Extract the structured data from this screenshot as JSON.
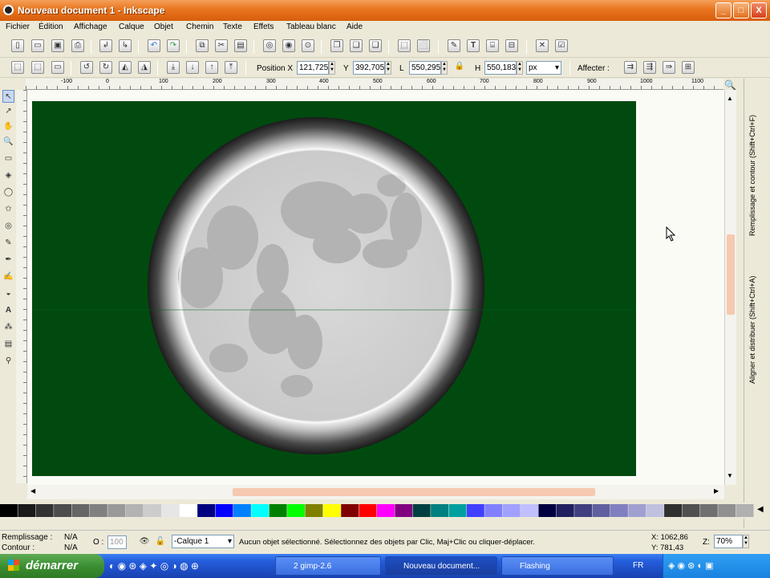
{
  "window": {
    "title": "Nouveau document 1 - Inkscape",
    "btn_min": "_",
    "btn_max": "□",
    "btn_close": "X"
  },
  "menu": [
    "Fichier",
    "Édition",
    "Affichage",
    "Calque",
    "Objet",
    "Chemin",
    "Texte",
    "Effets",
    "Tableau blanc",
    "Aide"
  ],
  "toolbar": {
    "position_x_label": "Position X",
    "x_value": "121,725",
    "y_label": "Y",
    "y_value": "392,705",
    "w_label": "L",
    "w_value": "550,295",
    "h_label": "H",
    "h_value": "550,183",
    "unit": "px",
    "affecter_label": "Affecter :"
  },
  "ruler": {
    "labels": [
      "-100",
      "0",
      "100",
      "200",
      "300",
      "400",
      "500",
      "600",
      "700",
      "800",
      "900",
      "1000",
      "1100"
    ]
  },
  "dock": {
    "tab1": "Remplissage et contour (Shift+Ctrl+F)",
    "tab2": "Aligner et distribuer (Shift+Ctrl+A)"
  },
  "colors": {
    "page_bg": "#004a0f",
    "moon_surface": "#d4d4d4",
    "moon_maria": "#b3b3b3"
  },
  "palette": [
    "#000000",
    "#1a1a1a",
    "#333333",
    "#4d4d4d",
    "#666666",
    "#808080",
    "#999999",
    "#b3b3b3",
    "#cccccc",
    "#e6e6e6",
    "#ffffff",
    "#000080",
    "#0000ff",
    "#0080ff",
    "#00ffff",
    "#008000",
    "#00ff00",
    "#808000",
    "#ffff00",
    "#800000",
    "#ff0000",
    "#ff00ff",
    "#800080",
    "#004040",
    "#008080",
    "#00a0a0",
    "#4040ff",
    "#8080ff",
    "#a0a0ff",
    "#c0c0ff",
    "#000040",
    "#202060",
    "#404080",
    "#6060a0",
    "#8080c0",
    "#a0a0d0",
    "#c0c0e0",
    "#303030",
    "#505050",
    "#707070",
    "#909090",
    "#b0b0b0"
  ],
  "status": {
    "fill_label": "Remplissage :",
    "fill_value": "N/A",
    "stroke_label": "Contour :",
    "stroke_value": "N/A",
    "opacity_label": "O :",
    "opacity_value": "100",
    "layer": "-Calque 1",
    "message": "Aucun objet sélectionné. Sélectionnez des objets par Clic, Maj+Clic ou cliquer-déplacer.",
    "x_coord": "X: 1062,86",
    "y_coord": "Y: 781,43",
    "zoom_label": "Z:",
    "zoom_value": "70%"
  },
  "taskbar": {
    "start": "démarrer",
    "tasks": [
      "2 gimp-2.6",
      "Nouveau document...",
      "Flashing"
    ],
    "lang": "FR"
  }
}
